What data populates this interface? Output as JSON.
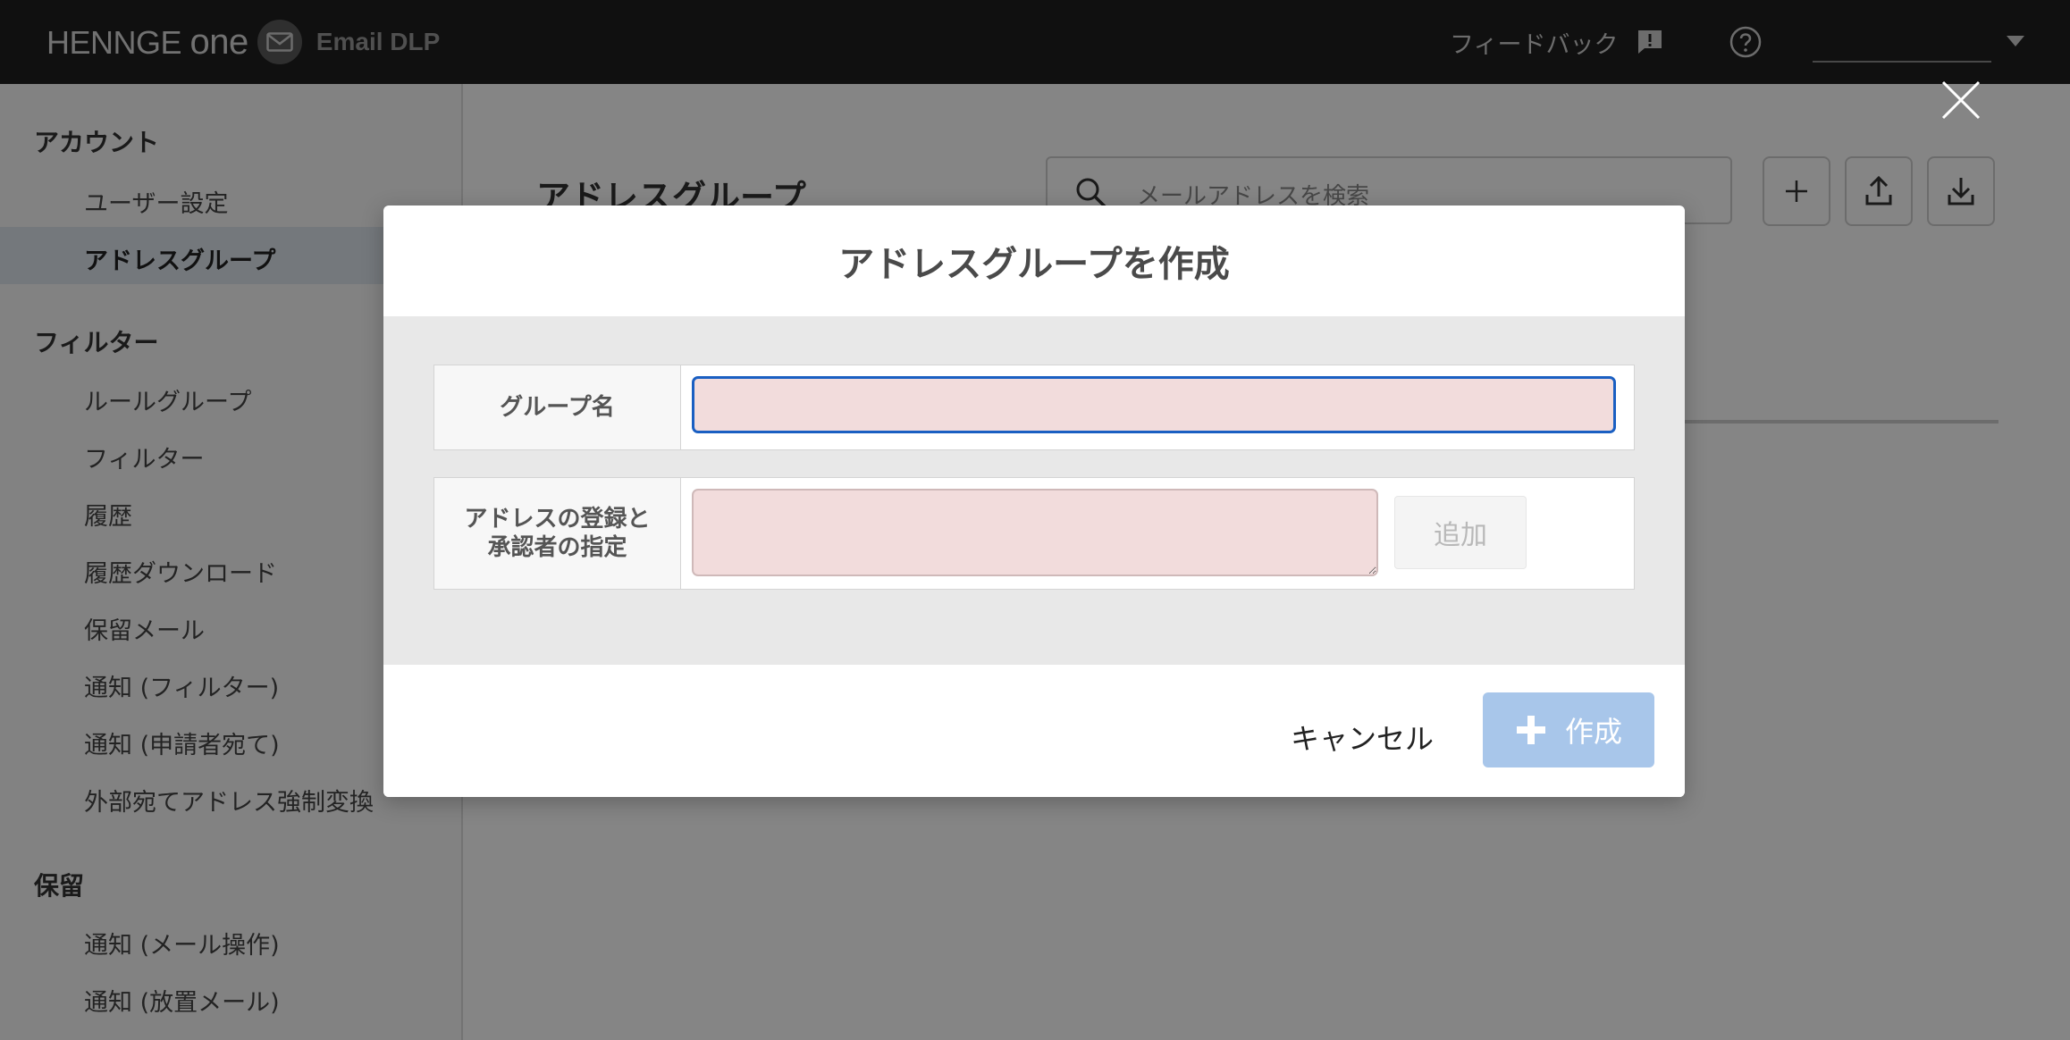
{
  "topbar": {
    "brand_name": "HENNGE",
    "brand_suffix": "one",
    "product_name": "Email DLP",
    "feedback_label": "フィードバック",
    "user_name": ""
  },
  "sidebar": {
    "sections": [
      {
        "title": "アカウント",
        "items": [
          "ユーザー設定",
          "アドレスグループ"
        ]
      },
      {
        "title": "フィルター",
        "items": [
          "ルールグループ",
          "フィルター",
          "履歴",
          "履歴ダウンロード",
          "保留メール",
          "通知 (フィルター)",
          "通知 (申請者宛て)",
          "外部宛てアドレス強制変換"
        ]
      },
      {
        "title": "保留",
        "items": [
          "通知 (メール操作)",
          "通知 (放置メール)"
        ]
      }
    ],
    "active_item": "アドレスグループ"
  },
  "main": {
    "title": "アドレスグループ",
    "search_placeholder": "メールアドレスを検索"
  },
  "modal": {
    "title": "アドレスグループを作成",
    "group_name_label": "グループ名",
    "group_name_value": "",
    "address_label": "アドレスの登録と\n承認者の指定",
    "address_value": "",
    "add_button": "追加",
    "cancel_button": "キャンセル",
    "create_button": "作成"
  },
  "colors": {
    "topbar": "#1f1f1f",
    "input_error_bg": "#f2dcdc",
    "focus_border": "#1a5fc2",
    "create_button_disabled": "#a8c6ea"
  }
}
